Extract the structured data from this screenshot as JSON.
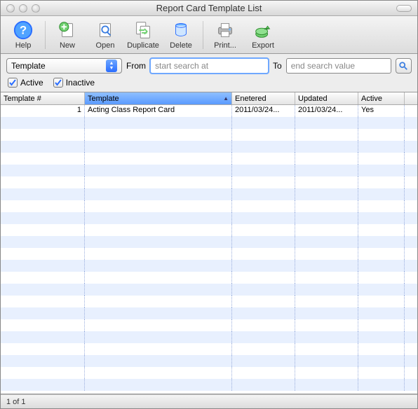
{
  "window": {
    "title": "Report Card Template List"
  },
  "toolbar": {
    "help": "Help",
    "new": "New",
    "open": "Open",
    "duplicate": "Duplicate",
    "delete": "Delete",
    "print": "Print...",
    "export": "Export"
  },
  "search": {
    "combo_label": "Template",
    "from_label": "From",
    "to_label": "To",
    "from_placeholder": "start search at",
    "to_placeholder": "end search value",
    "from_value": "",
    "to_value": "",
    "active_label": "Active",
    "inactive_label": "Inactive",
    "active_checked": true,
    "inactive_checked": true
  },
  "table": {
    "columns": [
      "Template #",
      "Template",
      "Enetered",
      "Updated",
      "Active"
    ],
    "sorted_column_index": 1,
    "rows": [
      {
        "template_no": "1",
        "template": "Acting Class Report Card",
        "entered": "2011/03/24...",
        "updated": "2011/03/24...",
        "active": "Yes"
      }
    ]
  },
  "status": {
    "count_text": "1 of 1"
  },
  "colors": {
    "accent": "#5a9bff",
    "row_even": "#e8f0fe"
  }
}
